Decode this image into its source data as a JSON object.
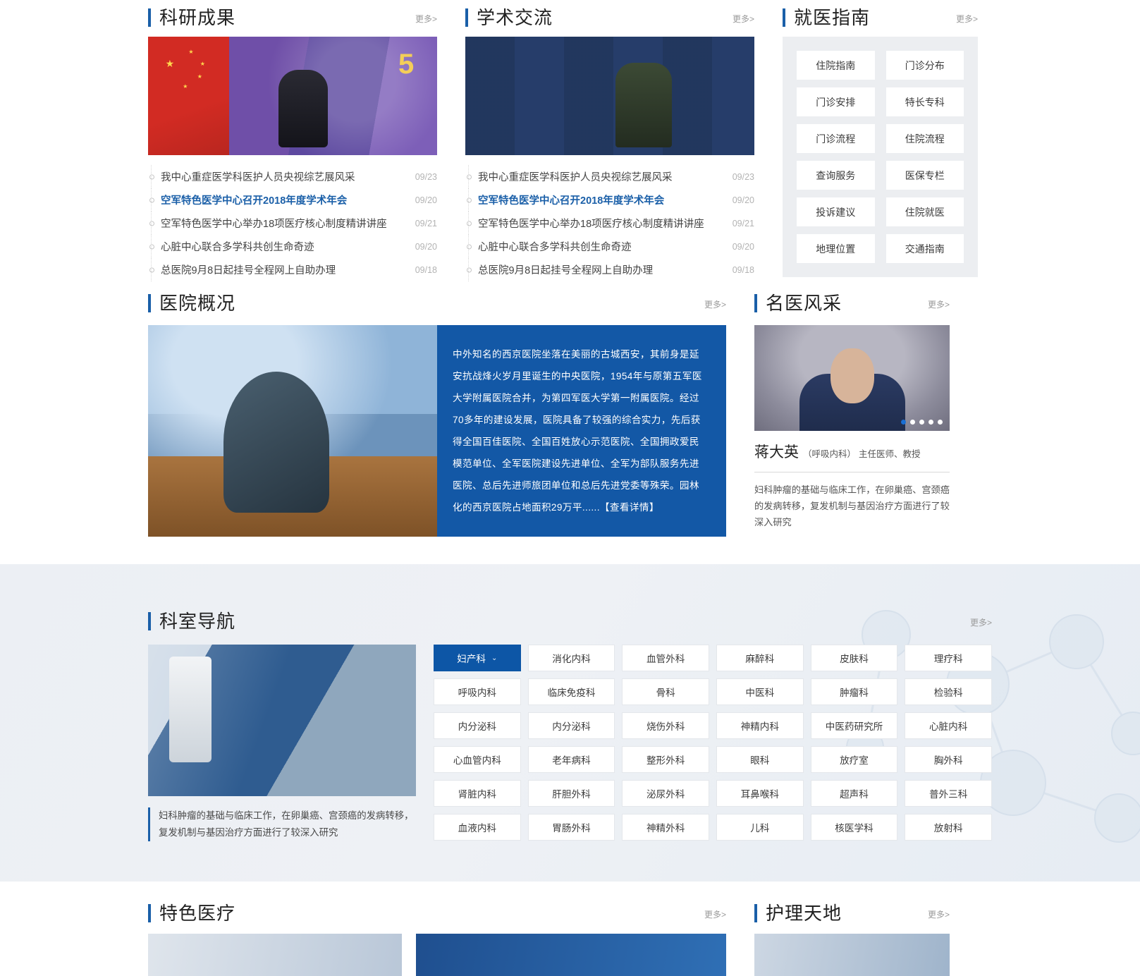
{
  "common": {
    "more_label": "更多>"
  },
  "research": {
    "title": "科研成果",
    "image_alt": "主席讲话图片",
    "items": [
      {
        "title": "我中心重症医学科医护人员央视综艺展风采",
        "date": "09/23",
        "active": false
      },
      {
        "title": "空军特色医学中心召开2018年度学术年会",
        "date": "09/20",
        "active": true
      },
      {
        "title": "空军特色医学中心举办18项医疗核心制度精讲讲座",
        "date": "09/21",
        "active": false
      },
      {
        "title": "心脏中心联合多学科共创生命奇迹",
        "date": "09/20",
        "active": false
      },
      {
        "title": "总医院9月8日起挂号全程网上自助办理",
        "date": "09/18",
        "active": false
      }
    ]
  },
  "academic": {
    "title": "学术交流",
    "image_alt": "参观展览图片",
    "items": [
      {
        "title": "我中心重症医学科医护人员央视综艺展风采",
        "date": "09/23",
        "active": false
      },
      {
        "title": "空军特色医学中心召开2018年度学术年会",
        "date": "09/20",
        "active": true
      },
      {
        "title": "空军特色医学中心举办18项医疗核心制度精讲讲座",
        "date": "09/21",
        "active": false
      },
      {
        "title": "心脏中心联合多学科共创生命奇迹",
        "date": "09/20",
        "active": false
      },
      {
        "title": "总医院9月8日起挂号全程网上自助办理",
        "date": "09/18",
        "active": false
      }
    ]
  },
  "guide": {
    "title": "就医指南",
    "buttons": [
      "住院指南",
      "门诊分布",
      "门诊安排",
      "特长专科",
      "门诊流程",
      "住院流程",
      "查询服务",
      "医保专栏",
      "投诉建议",
      "住院就医",
      "地理位置",
      "交通指南"
    ]
  },
  "overview": {
    "title": "医院概况",
    "image_alt": "石狮与古建筑图片",
    "body": "中外知名的西京医院坐落在美丽的古城西安，其前身是延安抗战烽火岁月里诞生的中央医院，1954年与原第五军医大学附属医院合并，为第四军医大学第一附属医院。经过70多年的建设发展，医院具备了较强的综合实力，先后获得全国百佳医院、全国百姓放心示范医院、全国拥政爱民模范单位、全军医院建设先进单位、全军为部队服务先进医院、总后先进师旅团单位和总后先进党委等殊荣。园林化的西京医院占地面积29万平......",
    "detail_link": "【查看详情】"
  },
  "doctor": {
    "title": "名医风采",
    "image_alt": "医生证件照",
    "name": "蒋大英",
    "department": "（呼吸内科）",
    "rank": "主任医师、教授",
    "description": "妇科肿瘤的基础与临床工作，在卵巢癌、宫颈癌的发病转移，复发机制与基因治疗方面进行了较深入研究",
    "dots_total": 5,
    "dot_active_index": 0,
    "accent": "#1a6fd4"
  },
  "departments": {
    "title": "科室导航",
    "image_alt": "手术室护理图片",
    "caption": "妇科肿瘤的基础与临床工作，在卵巢癌、宫颈癌的发病转移，复发机制与基因治疗方面进行了较深入研究",
    "selected": "妇产科",
    "selected_caret": "⌄",
    "items": [
      "妇产科",
      "消化内科",
      "血管外科",
      "麻醉科",
      "皮肤科",
      "理疗科",
      "呼吸内科",
      "临床免疫科",
      "骨科",
      "中医科",
      "肿瘤科",
      "检验科",
      "内分泌科",
      "内分泌科",
      "烧伤外科",
      "神精内科",
      "中医药研究所",
      "心脏内科",
      "心血管内科",
      "老年病科",
      "整形外科",
      "眼科",
      "放疗室",
      "胸外科",
      "肾脏内科",
      "肝胆外科",
      "泌尿外科",
      "耳鼻喉科",
      "超声科",
      "普外三科",
      "血液内科",
      "胃肠外科",
      "神精外科",
      "儿科",
      "核医学科",
      "放射科"
    ]
  },
  "featured": {
    "title": "特色医疗"
  },
  "nursing": {
    "title": "护理天地"
  },
  "theme": {
    "accent_blue": "#1a5fa8",
    "selected_blue": "#0d56a6",
    "link_blue": "#1a5fa8",
    "panel_gray": "#eceef1",
    "band_gray": "#eceff4"
  }
}
